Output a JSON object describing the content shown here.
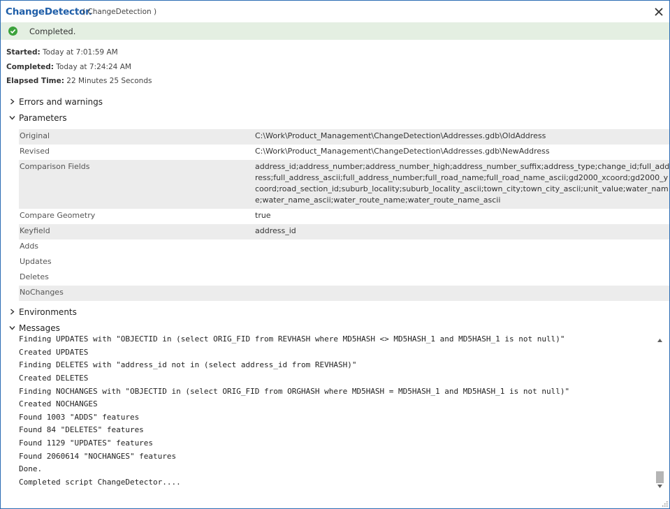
{
  "window": {
    "title": "ChangeDetector.",
    "subtitle": "( ChangeDetection )",
    "close_icon": "close-icon"
  },
  "status": {
    "icon": "check-circle-icon",
    "text": "Completed.",
    "color": "#3ba23b",
    "background": "#e4efe2"
  },
  "info": {
    "started_label": "Started:",
    "started_value": "Today at 7:01:59 AM",
    "completed_label": "Completed:",
    "completed_value": "Today at 7:24:24 AM",
    "elapsed_label": "Elapsed Time:",
    "elapsed_value": "22 Minutes 25 Seconds"
  },
  "sections": {
    "errors": "Errors and warnings",
    "parameters": "Parameters",
    "environments": "Environments",
    "messages": "Messages"
  },
  "parameters": [
    {
      "name": "Original",
      "value": "C:\\Work\\Product_Management\\ChangeDetection\\Addresses.gdb\\OldAddress"
    },
    {
      "name": "Revised",
      "value": "C:\\Work\\Product_Management\\ChangeDetection\\Addresses.gdb\\NewAddress"
    },
    {
      "name": "Comparison Fields",
      "value": "address_id;address_number;address_number_high;address_number_suffix;address_type;change_id;full_address;full_address_ascii;full_address_number;full_road_name;full_road_name_ascii;gd2000_xcoord;gd2000_ycoord;road_section_id;suburb_locality;suburb_locality_ascii;town_city;town_city_ascii;unit_value;water_name;water_name_ascii;water_route_name;water_route_name_ascii"
    },
    {
      "name": "Compare Geometry",
      "value": "true"
    },
    {
      "name": "Keyfield",
      "value": "address_id"
    },
    {
      "name": "Adds",
      "value": ""
    },
    {
      "name": "Updates",
      "value": ""
    },
    {
      "name": "Deletes",
      "value": ""
    },
    {
      "name": "NoChanges",
      "value": ""
    }
  ],
  "messages": [
    "Finding UPDATES with \"OBJECTID in (select ORIG_FID from REVHASH where MD5HASH <> MD5HASH_1 and MD5HASH_1 is not null)\"",
    "Created UPDATES",
    "Finding DELETES with \"address_id not in (select address_id from REVHASH)\"",
    "Created DELETES",
    "Finding NOCHANGES with \"OBJECTID in (select ORIG_FID from ORGHASH where MD5HASH = MD5HASH_1 and MD5HASH_1 is not null)\"",
    "Created NOCHANGES",
    "Found 1003 \"ADDS\" features",
    "Found 84 \"DELETES\" features",
    "Found 1129 \"UPDATES\" features",
    "Found 2060614 \"NOCHANGES\" features",
    "Done.",
    "Completed script ChangeDetector...."
  ],
  "scrollbar": {
    "position": 0.98
  }
}
